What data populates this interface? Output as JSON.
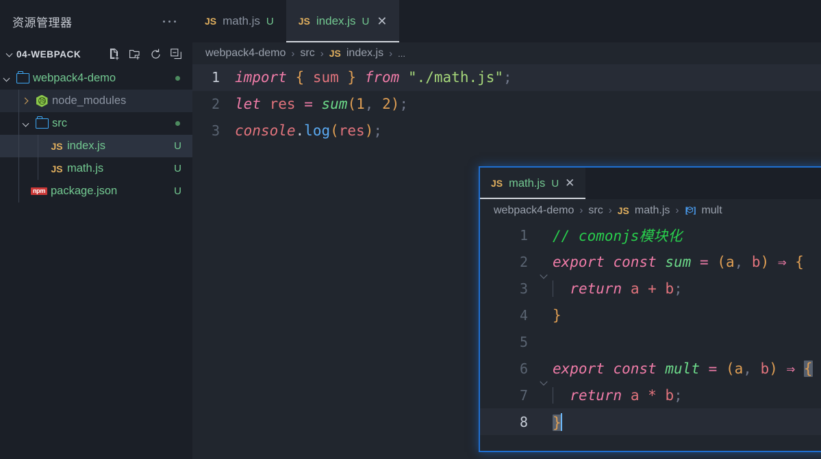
{
  "sidebar": {
    "title": "资源管理器",
    "more_actions_label": "...",
    "section": {
      "label": "04-WEBPACK",
      "actions": [
        {
          "name": "new-file-icon",
          "label": "新建文件"
        },
        {
          "name": "new-folder-icon",
          "label": "新建文件夹"
        },
        {
          "name": "refresh-icon",
          "label": "刷新"
        },
        {
          "name": "collapse-all-icon",
          "label": "全部折叠"
        }
      ]
    },
    "tree": [
      {
        "label": "webpack4-demo",
        "icon": "folder-icon",
        "type": "folder",
        "expanded": true,
        "indent": 0,
        "status_dot": true,
        "badge": ""
      },
      {
        "label": "node_modules",
        "icon": "nodejs-icon",
        "type": "folder",
        "expanded": false,
        "indent": 1,
        "dim": true,
        "badge": ""
      },
      {
        "label": "src",
        "icon": "folder-icon",
        "type": "folder",
        "expanded": true,
        "indent": 1,
        "status_dot": true,
        "badge": ""
      },
      {
        "label": "index.js",
        "icon": "js-icon",
        "type": "file",
        "indent": 2,
        "selected": true,
        "badge": "U"
      },
      {
        "label": "math.js",
        "icon": "js-icon",
        "type": "file",
        "indent": 2,
        "badge": "U"
      },
      {
        "label": "package.json",
        "icon": "npm-icon",
        "type": "file",
        "indent": 2,
        "badge": "U"
      }
    ]
  },
  "tabs": [
    {
      "label": "math.js",
      "icon": "js-icon",
      "badge": "U",
      "active": false,
      "close": ""
    },
    {
      "label": "index.js",
      "icon": "js-icon",
      "badge": "U",
      "active": true,
      "close": "✕"
    }
  ],
  "breadcrumb": {
    "items": [
      "webpack4-demo",
      "src",
      "index.js",
      "..."
    ],
    "file_icon": "js-icon",
    "separator": "›"
  },
  "editor": {
    "file": "index.js",
    "lines": [
      {
        "no": "1",
        "current": true
      },
      {
        "no": "2",
        "current": false
      },
      {
        "no": "3",
        "current": false
      }
    ],
    "code": {
      "l1": {
        "kw_import": "import",
        "brace_open": "{",
        "name": "sum",
        "brace_close": "}",
        "kw_from": "from",
        "path": "\"./math.js\"",
        "semi": ";"
      },
      "l2": {
        "kw_let": "let",
        "var": "res",
        "eq": "=",
        "fn": "sum",
        "paren_open": "(",
        "a": "1",
        "comma": ",",
        "b": "2",
        "paren_close": ")",
        "semi": ";"
      },
      "l3": {
        "obj": "console",
        "dot": ".",
        "prop": "log",
        "paren_open": "(",
        "arg": "res",
        "paren_close": ")",
        "semi": ";"
      }
    }
  },
  "peek": {
    "tab": {
      "label": "math.js",
      "icon": "js-icon",
      "badge": "U",
      "close": "✕"
    },
    "breadcrumb": {
      "items": [
        "webpack4-demo",
        "src",
        "math.js",
        "mult"
      ],
      "symbol_icon": "symbol-variable-icon",
      "separator": "›"
    },
    "lines": [
      {
        "no": "1",
        "fold": false,
        "indent_guide": false,
        "current": false
      },
      {
        "no": "2",
        "fold": true,
        "indent_guide": false,
        "current": false
      },
      {
        "no": "3",
        "fold": false,
        "indent_guide": true,
        "current": false
      },
      {
        "no": "4",
        "fold": false,
        "indent_guide": false,
        "current": false
      },
      {
        "no": "5",
        "fold": false,
        "indent_guide": false,
        "current": false
      },
      {
        "no": "6",
        "fold": true,
        "indent_guide": false,
        "current": false
      },
      {
        "no": "7",
        "fold": false,
        "indent_guide": true,
        "current": false
      },
      {
        "no": "8",
        "fold": false,
        "indent_guide": false,
        "current": true
      }
    ],
    "code": {
      "l1": {
        "comment": "// comonjs模块化"
      },
      "l2": {
        "kw_export": "export",
        "kw_const": "const",
        "name": "sum",
        "eq": "=",
        "paren_open": "(",
        "p1": "a",
        "comma": ",",
        "p2": "b",
        "paren_close": ")",
        "arrow": "⇒",
        "brace": "{"
      },
      "l3": {
        "kw_return": "return",
        "a": "a",
        "op": "+",
        "b": "b",
        "semi": ";"
      },
      "l4": {
        "brace": "}"
      },
      "l5": {
        "empty": ""
      },
      "l6": {
        "kw_export": "export",
        "kw_const": "const",
        "name": "mult",
        "eq": "=",
        "paren_open": "(",
        "p1": "a",
        "comma": ",",
        "p2": "b",
        "paren_close": ")",
        "arrow": "⇒",
        "brace": "{"
      },
      "l7": {
        "kw_return": "return",
        "a": "a",
        "op": "*",
        "b": "b",
        "semi": ";"
      },
      "l8": {
        "brace": "}"
      }
    }
  },
  "colors": {
    "sidebar_bg": "#1b1f27",
    "editor_bg": "#21262e",
    "peek_border": "#1f6fd0",
    "accent_green": "#73c991",
    "js_badge": "#e2b05e",
    "npm_red": "#cb3837",
    "folder_blue": "#3fa9f5",
    "comment_green": "#29cf4d",
    "keyword_pink": "#f07ca8",
    "string_green": "#a6d77a",
    "cursor_blue": "#6cb6f5"
  }
}
